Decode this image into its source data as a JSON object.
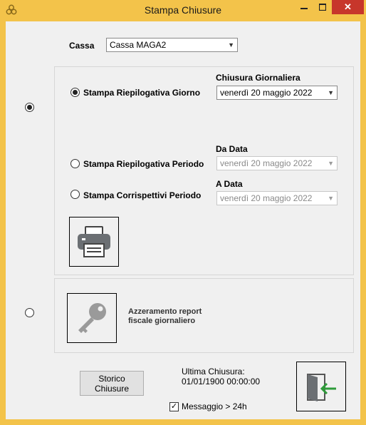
{
  "window": {
    "title": "Stampa Chiusure",
    "close_glyph": "✕",
    "accent_color": "#f3c34a"
  },
  "cassa": {
    "label": "Cassa",
    "selected": "Cassa MAGA2"
  },
  "print_group": {
    "selected": true,
    "chiusura_label": "Chiusura Giornaliera",
    "option_giorno": "Stampa Riepilogativa Giorno",
    "giorno_date": {
      "day_name": "venerdì",
      "day": "20",
      "month": "maggio",
      "year": "2022"
    },
    "da_data_label": "Da Data",
    "option_periodo": "Stampa Riepilogativa Periodo",
    "da_date": {
      "day_name": "venerdì",
      "day": "20",
      "month": "maggio",
      "year": "2022"
    },
    "a_data_label": "A Data",
    "option_corrispettivi": "Stampa Corrispettivi Periodo",
    "a_date": {
      "day_name": "venerdì",
      "day": "20",
      "month": "maggio",
      "year": "2022"
    },
    "selected_option": "Stampa Riepilogativa Giorno",
    "print_icon": "printer-icon"
  },
  "reset_group": {
    "selected": false,
    "label_line1": "Azzeramento report",
    "label_line2": "fiscale giornaliero",
    "icon": "key-icon"
  },
  "footer": {
    "storico_line1": "Storico",
    "storico_line2": "Chiusure",
    "ultima_label": "Ultima Chiusura:",
    "ultima_value": "01/01/1900  00:00:00",
    "messaggio_label": "Messaggio > 24h",
    "messaggio_checked": true,
    "exit_icon": "exit-door-icon"
  }
}
